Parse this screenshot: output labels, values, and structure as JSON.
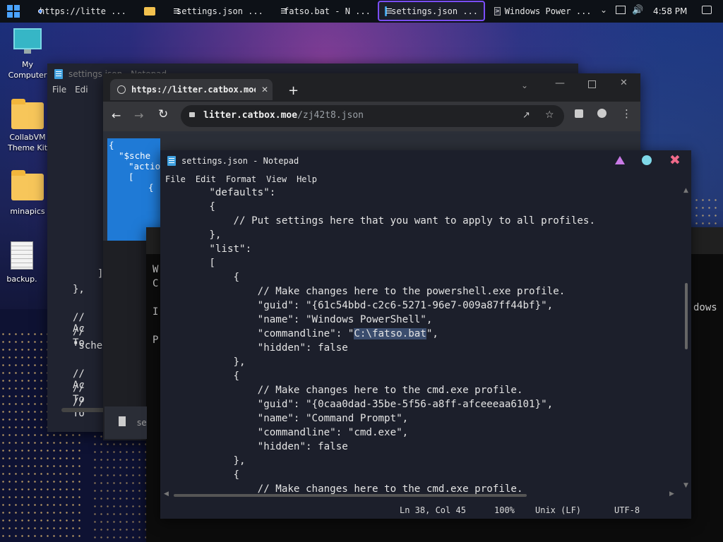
{
  "taskbar": {
    "items": [
      {
        "label": "https://litte ...",
        "icon": "chrome-icon"
      },
      {
        "label": "",
        "icon": "file-explorer-icon"
      },
      {
        "label": "settings.json ...",
        "icon": "notepad-icon"
      },
      {
        "label": "fatso.bat - N ...",
        "icon": "notepad-icon"
      },
      {
        "label": "settings.json ...",
        "icon": "notepad-icon"
      },
      {
        "label": "Windows Power ...",
        "icon": "powershell-icon"
      }
    ],
    "time": "4:58 PM"
  },
  "desktop": {
    "icons": [
      {
        "label": "My Computer"
      },
      {
        "label": "CollabVM Theme Kit"
      },
      {
        "label": "minapics"
      },
      {
        "label": "backup."
      }
    ]
  },
  "back_notepad": {
    "title": "settings.json - Notepad",
    "menu": [
      "File",
      "Edi"
    ],
    "lines": [
      "]",
      "},",
      "// Ac",
      "// To",
      "\"sche",
      "// Ac",
      "// To",
      "// To"
    ]
  },
  "browser": {
    "tab_title": "https://litter.catbox.moe",
    "url_host": "litter.catbox.moe",
    "url_path": "/zj42t8.json",
    "content_lines": [
      "{",
      "\"$sche",
      "\"actio",
      "[",
      "{"
    ]
  },
  "powershell": {
    "lines": [
      "W",
      "C",
      "I",
      "P"
    ],
    "right_text": "dows"
  },
  "taskbar_preview": {
    "label": "se"
  },
  "notepad": {
    "title": "settings.json - Notepad",
    "menu": [
      "File",
      "Edit",
      "Format",
      "View",
      "Help"
    ],
    "lines": [
      "        \"defaults\":",
      "        {",
      "            // Put settings here that you want to apply to all profiles.",
      "        },",
      "        \"list\":",
      "        [",
      "            {",
      "                // Make changes here to the powershell.exe profile.",
      "                \"guid\": \"{61c54bbd-c2c6-5271-96e7-009a87ff44bf}\",",
      "                \"name\": \"Windows PowerShell\",",
      "                \"commandline\": \"C:\\fatso.bat\",",
      "                \"hidden\": false",
      "            },",
      "            {",
      "                // Make changes here to the cmd.exe profile.",
      "                \"guid\": \"{0caa0dad-35be-5f56-a8ff-afceeeaa6101}\",",
      "                \"name\": \"Command Prompt\",",
      "                \"commandline\": \"cmd.exe\",",
      "                \"hidden\": false",
      "            },",
      "            {",
      "                // Make changes here to the cmd.exe profile."
    ],
    "selected_text": "C:\\fatso.bat",
    "status": {
      "position": "Ln 38, Col 45",
      "zoom": "100%",
      "line_ending": "Unix (LF)",
      "encoding": "UTF-8"
    }
  },
  "colors": {
    "accent": "#7a4dff",
    "minimize_btn": "#c97ae6",
    "maximize_btn": "#7fd8e8",
    "close_btn": "#f06a8a"
  }
}
